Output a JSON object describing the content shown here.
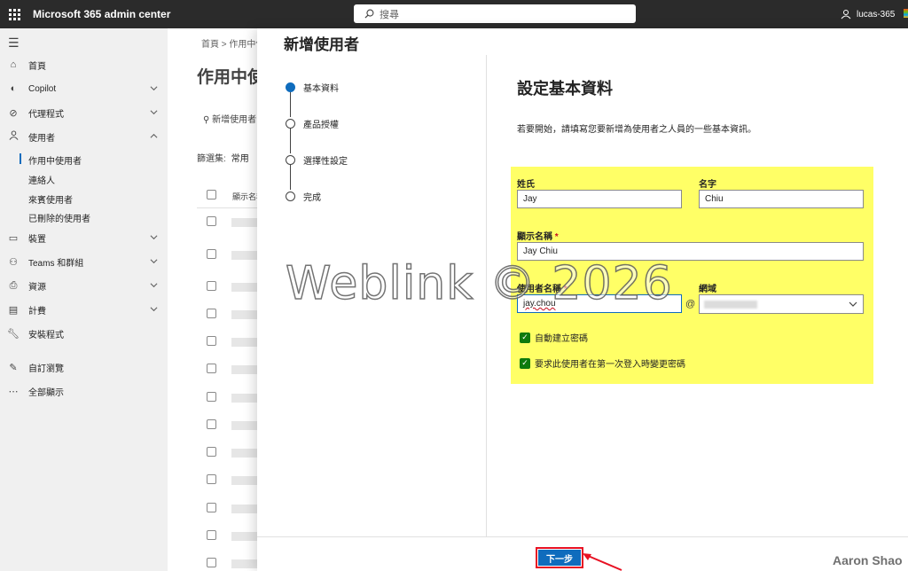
{
  "topbar": {
    "app_title": "Microsoft 365 admin center",
    "search_placeholder": "搜尋",
    "user_name": "lucas-365"
  },
  "leftnav": {
    "items": [
      {
        "label": "首頁",
        "icon": "home-icon"
      },
      {
        "label": "Copilot",
        "icon": "copilot-icon"
      },
      {
        "label": "代理程式",
        "icon": "agents-icon"
      },
      {
        "label": "使用者",
        "icon": "user-icon"
      },
      {
        "label": "裝置",
        "icon": "devices-icon"
      },
      {
        "label": "Teams 和群組",
        "icon": "teams-icon"
      },
      {
        "label": "資源",
        "icon": "resources-icon"
      },
      {
        "label": "計費",
        "icon": "billing-icon"
      },
      {
        "label": "安裝程式",
        "icon": "setup-icon"
      },
      {
        "label": "自訂瀏覽",
        "icon": "pencil-icon"
      },
      {
        "label": "全部顯示",
        "icon": "more-icon"
      }
    ],
    "user_subitems": [
      "作用中使用者",
      "連絡人",
      "來賓使用者",
      "已刪除的使用者"
    ]
  },
  "background_page": {
    "breadcrumb": "首頁  >  作用中使",
    "title": "作用中使",
    "add_user": "新增使用者",
    "filter_label": "篩選集:",
    "filter_value": "常用",
    "column_header": "顯示名稱"
  },
  "panel": {
    "title": "新增使用者",
    "steps": [
      {
        "label": "基本資料",
        "active": true
      },
      {
        "label": "產品授權",
        "active": false
      },
      {
        "label": "選擇性設定",
        "active": false
      },
      {
        "label": "完成",
        "active": false
      }
    ],
    "form_title": "設定基本資料",
    "form_description": "若要開始，請填寫您要新增為使用者之人員的一些基本資訊。",
    "fields": {
      "last_name_label": "姓氏",
      "last_name_value": "Jay",
      "first_name_label": "名字",
      "first_name_value": "Chiu",
      "display_name_label": "顯示名稱",
      "display_name_value": "Jay Chiu",
      "username_label": "使用者名稱",
      "username_value": "jay.chou",
      "domain_label": "網域",
      "at_symbol": "@",
      "required_mark": "*"
    },
    "checkboxes": [
      {
        "label": "自動建立密碼",
        "checked": true
      },
      {
        "label": "要求此使用者在第一次登入時變更密碼",
        "checked": true
      }
    ],
    "next_button": "下一步"
  },
  "overlay": {
    "watermark": "Weblink © 2026",
    "author": "Aaron Shao"
  },
  "colors": {
    "accent": "#0f6cbd",
    "highlight": "#ffff66",
    "checkbox_green": "#0e7a0d",
    "annotation_red": "#e81123"
  }
}
